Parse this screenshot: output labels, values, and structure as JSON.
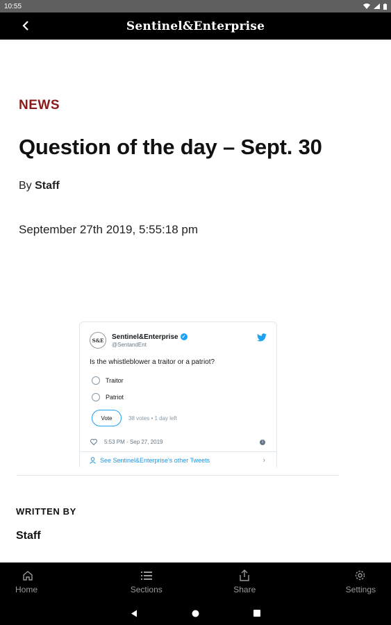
{
  "status_bar": {
    "time": "10:55"
  },
  "app_bar": {
    "masthead": "Sentinel&Enterprise"
  },
  "article": {
    "section": "NEWS",
    "headline": "Question of the day – Sept. 30",
    "byline_prefix": "By",
    "byline_author": "Staff",
    "date": "September 27th 2019, 5:55:18 pm"
  },
  "tweet": {
    "avatar_text": "S&E",
    "name": "Sentinel&Enterprise",
    "handle": "@SentandEnt",
    "question": "Is the whistleblower a traitor or a patriot?",
    "options": [
      "Traitor",
      "Patriot"
    ],
    "vote_label": "Vote",
    "poll_meta": "38 votes • 1 day left",
    "timestamp": "5:53 PM - Sep 27, 2019",
    "more_link": "See Sentinel&Enterprise's other Tweets"
  },
  "written_by": {
    "heading": "WRITTEN BY",
    "author": "Staff"
  },
  "bottom_nav": {
    "items": [
      {
        "label": "Home",
        "icon": "home-icon"
      },
      {
        "label": "Sections",
        "icon": "list-icon"
      },
      {
        "label": "Share",
        "icon": "share-icon"
      },
      {
        "label": "Settings",
        "icon": "gear-icon"
      }
    ]
  },
  "colors": {
    "section": "#8b1a1a",
    "twitter_blue": "#1da1f2",
    "bar": "#000000"
  }
}
